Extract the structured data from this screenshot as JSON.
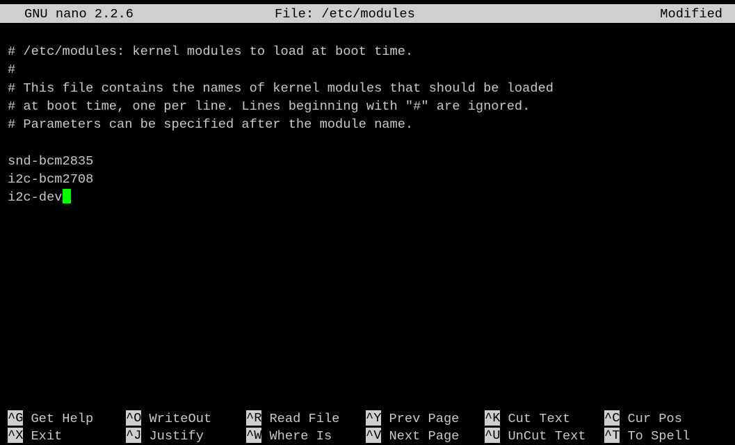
{
  "title_bar": {
    "version": "GNU nano 2.2.6",
    "file": "File: /etc/modules",
    "status": "Modified"
  },
  "colors": {
    "background": "#000000",
    "text": "#c8c8c8",
    "bar": "#cfcfcf",
    "cursor": "#00ff00"
  },
  "editor": {
    "lines": [
      "# /etc/modules: kernel modules to load at boot time.",
      "#",
      "# This file contains the names of kernel modules that should be loaded",
      "# at boot time, one per line. Lines beginning with \"#\" are ignored.",
      "# Parameters can be specified after the module name.",
      "",
      "snd-bcm2835",
      "i2c-bcm2708",
      "i2c-dev"
    ]
  },
  "shortcuts": {
    "row1": [
      {
        "key": "^G",
        "label": "Get Help"
      },
      {
        "key": "^O",
        "label": "WriteOut"
      },
      {
        "key": "^R",
        "label": "Read File"
      },
      {
        "key": "^Y",
        "label": "Prev Page"
      },
      {
        "key": "^K",
        "label": "Cut Text"
      },
      {
        "key": "^C",
        "label": "Cur Pos"
      }
    ],
    "row2": [
      {
        "key": "^X",
        "label": "Exit"
      },
      {
        "key": "^J",
        "label": "Justify"
      },
      {
        "key": "^W",
        "label": "Where Is"
      },
      {
        "key": "^V",
        "label": "Next Page"
      },
      {
        "key": "^U",
        "label": "UnCut Text"
      },
      {
        "key": "^T",
        "label": "To Spell"
      }
    ]
  }
}
